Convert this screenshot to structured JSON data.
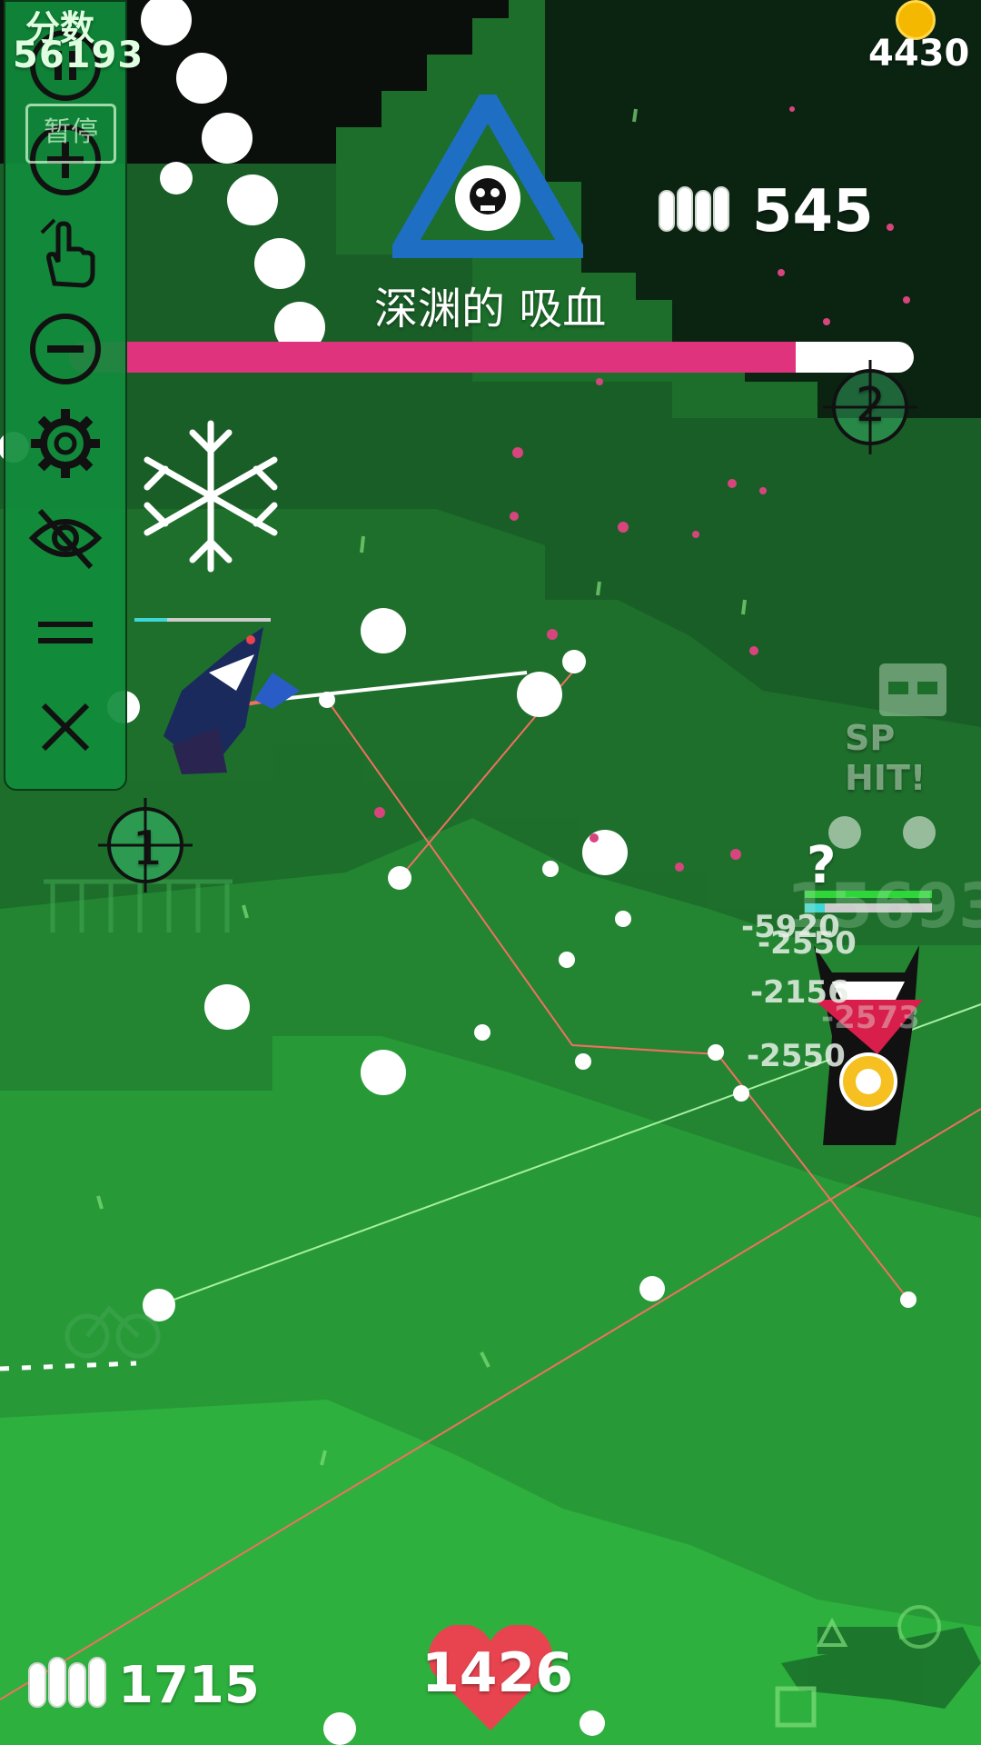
{
  "hud": {
    "score_label": "分数",
    "score_value": "56193",
    "pause_label": "暂停",
    "coins": "4430",
    "boss_name": "深渊的 吸血",
    "boss_ammo": "545",
    "boss_hp_fraction": 0.86,
    "player_ammo": "1715",
    "player_health": "1426",
    "sp_hit_label": "SP HIT!",
    "marker_1": "1",
    "marker_2": "2",
    "question_mark": "?",
    "damage_numbers": [
      "-5920",
      "-2550",
      "-2156",
      "-2550",
      "-2573"
    ]
  },
  "toolbar": {
    "items": [
      {
        "icon": "pause-icon"
      },
      {
        "icon": "zoom-in-icon"
      },
      {
        "icon": "tap-hand-icon"
      },
      {
        "icon": "zoom-out-icon"
      },
      {
        "icon": "gear-icon"
      },
      {
        "icon": "eye-off-icon"
      },
      {
        "icon": "menu-icon"
      },
      {
        "icon": "close-icon"
      }
    ]
  },
  "colors": {
    "boss_hp": "#e0337e",
    "coin": "#f5b800",
    "heart": "#e8444f",
    "boss_triangle": "#1e6fc4"
  }
}
